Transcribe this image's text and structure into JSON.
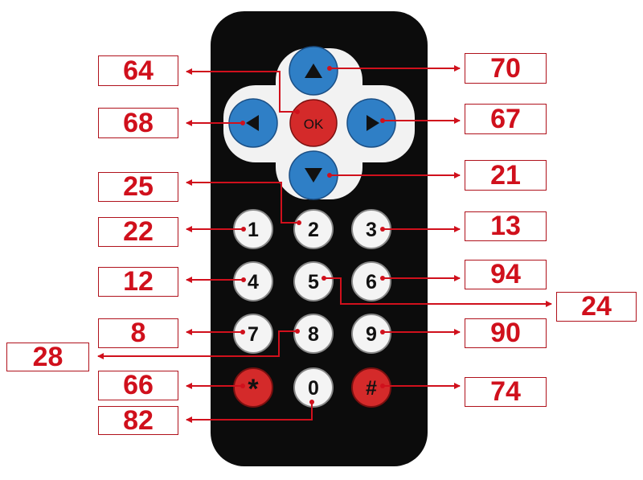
{
  "remote": {
    "body_color": "#0c0c0c",
    "dpad_plate_color": "#f2f2f2",
    "arrow_button_color": "#2f7fc6",
    "red_button_color": "#d42a2a",
    "white_button_color": "#f4f4f4",
    "label_color": "#d0101c",
    "buttons": {
      "up": {
        "icon": "triangle-up-icon",
        "code": "70"
      },
      "ok": {
        "label": "OK",
        "code": "64"
      },
      "left": {
        "icon": "triangle-left-icon",
        "code": "68"
      },
      "right": {
        "icon": "triangle-right-icon",
        "code": "67"
      },
      "down": {
        "icon": "triangle-down-icon",
        "code": "21"
      },
      "k1": {
        "label": "1",
        "code": "22"
      },
      "k2": {
        "label": "2",
        "code": "25"
      },
      "k3": {
        "label": "3",
        "code": "13"
      },
      "k4": {
        "label": "4",
        "code": "12"
      },
      "k5": {
        "label": "5",
        "code": "24"
      },
      "k6": {
        "label": "6",
        "code": "94"
      },
      "k7": {
        "label": "7",
        "code": "8"
      },
      "k8": {
        "label": "8",
        "code": "28"
      },
      "k9": {
        "label": "9",
        "code": "90"
      },
      "star": {
        "label": "*",
        "code": "66"
      },
      "k0": {
        "label": "0",
        "code": "82"
      },
      "hash": {
        "label": "#",
        "code": "74"
      }
    }
  }
}
